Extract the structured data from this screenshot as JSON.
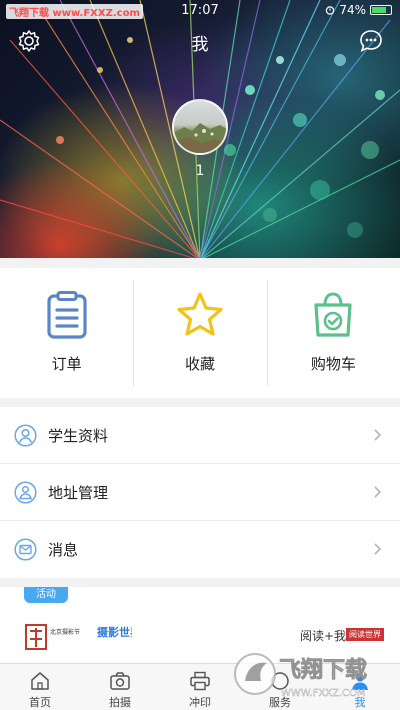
{
  "status": {
    "carrier": "飞翔下载 www.FXXZ.com",
    "time": "17:07",
    "battery": "74%"
  },
  "header": {
    "title": "我",
    "username": "1"
  },
  "quick_actions": [
    {
      "label": "订单"
    },
    {
      "label": "收藏"
    },
    {
      "label": "购物车"
    }
  ],
  "menu": [
    {
      "label": "学生资料"
    },
    {
      "label": "地址管理"
    },
    {
      "label": "消息"
    }
  ],
  "activity": {
    "tag": "活动",
    "logo1": "北京摄影节",
    "logo2": "摄影世界",
    "logo3": "阅读+我",
    "logo3_badge": "阅读世界"
  },
  "tabs": [
    {
      "label": "首页",
      "active": false
    },
    {
      "label": "拍摄",
      "active": false
    },
    {
      "label": "冲印",
      "active": false
    },
    {
      "label": "服务",
      "active": false
    },
    {
      "label": "我",
      "active": true
    }
  ],
  "watermark": {
    "title": "飞翔下载",
    "url": "WWW.FXXZ.COM"
  },
  "colors": {
    "accent": "#2e8ef0",
    "order_icon": "#5b86c6",
    "favorite_icon": "#f2c21a",
    "cart_icon": "#5cc08a",
    "menu_icon": "#6aa7e6",
    "activity_tag": "#48a8f0"
  }
}
